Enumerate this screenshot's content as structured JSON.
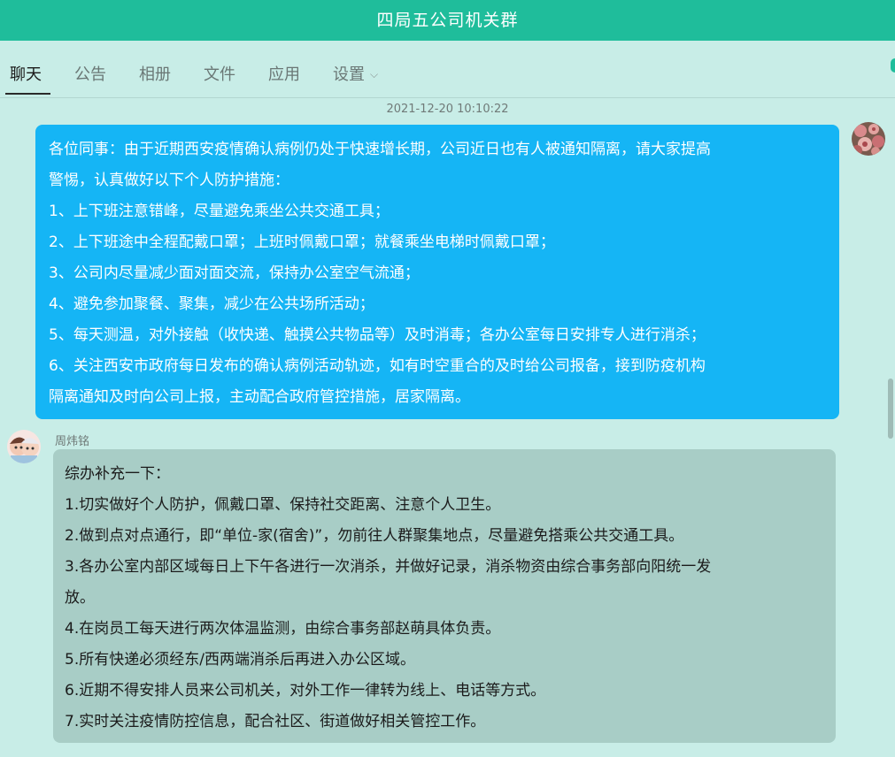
{
  "window": {
    "title": "四局五公司机关群"
  },
  "tabs": [
    {
      "label": "聊天",
      "active": true
    },
    {
      "label": "公告"
    },
    {
      "label": "相册"
    },
    {
      "label": "文件"
    },
    {
      "label": "应用"
    },
    {
      "label": "设置"
    }
  ],
  "chat": {
    "timestamp": "2021-12-20 10:10:22",
    "messages": [
      {
        "from_self": true,
        "lines": [
          "各位同事：由于近期西安疫情确认病例仍处于快速增长期，公司近日也有人被通知隔离，请大家提高",
          "警惕，认真做好以下个人防护措施：",
          "1、上下班注意错峰，尽量避免乘坐公共交通工具；",
          "2、上下班途中全程配戴口罩；上班时佩戴口罩；就餐乘坐电梯时佩戴口罩；",
          "3、公司内尽量减少面对面交流，保持办公室空气流通；",
          "4、避免参加聚餐、聚集，减少在公共场所活动；",
          "5、每天测温，对外接触（收快递、触摸公共物品等）及时消毒；各办公室每日安排专人进行消杀；",
          "6、关注西安市政府每日发布的确认病例活动轨迹，如有时空重合的及时给公司报备，接到防疫机构",
          "隔离通知及时向公司上报，主动配合政府管控措施，居家隔离。"
        ]
      },
      {
        "from_self": false,
        "sender": "周炜铭",
        "lines": [
          "综办补充一下：",
          "1.切实做好个人防护，佩戴口罩、保持社交距离、注意个人卫生。",
          "2.做到点对点通行，即“单位-家(宿舍)”，勿前往人群聚集地点，尽量避免搭乘公共交通工具。",
          "3.各办公室内部区域每日上下午各进行一次消杀，并做好记录，消杀物资由综合事务部向阳统一发",
          "放。",
          "4.在岗员工每天进行两次体温监测，由综合事务部赵萌具体负责。",
          "5.所有快递必须经东/西两端消杀后再进入办公区域。",
          "6.近期不得安排人员来公司机关，对外工作一律转为线上、电话等方式。",
          "7.实时关注疫情防控信息，配合社区、街道做好相关管控工作。"
        ]
      }
    ]
  },
  "colors": {
    "titlebar": "#1fbd9b",
    "background": "#c8ede7",
    "self_bubble": "#15b5f5",
    "other_bubble": "#a8cdc6"
  },
  "icons": {
    "settings_dropdown": "chevron-down-icon",
    "self_avatar": "avatar-flowers",
    "other_avatar": "avatar-cartoon-couple"
  }
}
